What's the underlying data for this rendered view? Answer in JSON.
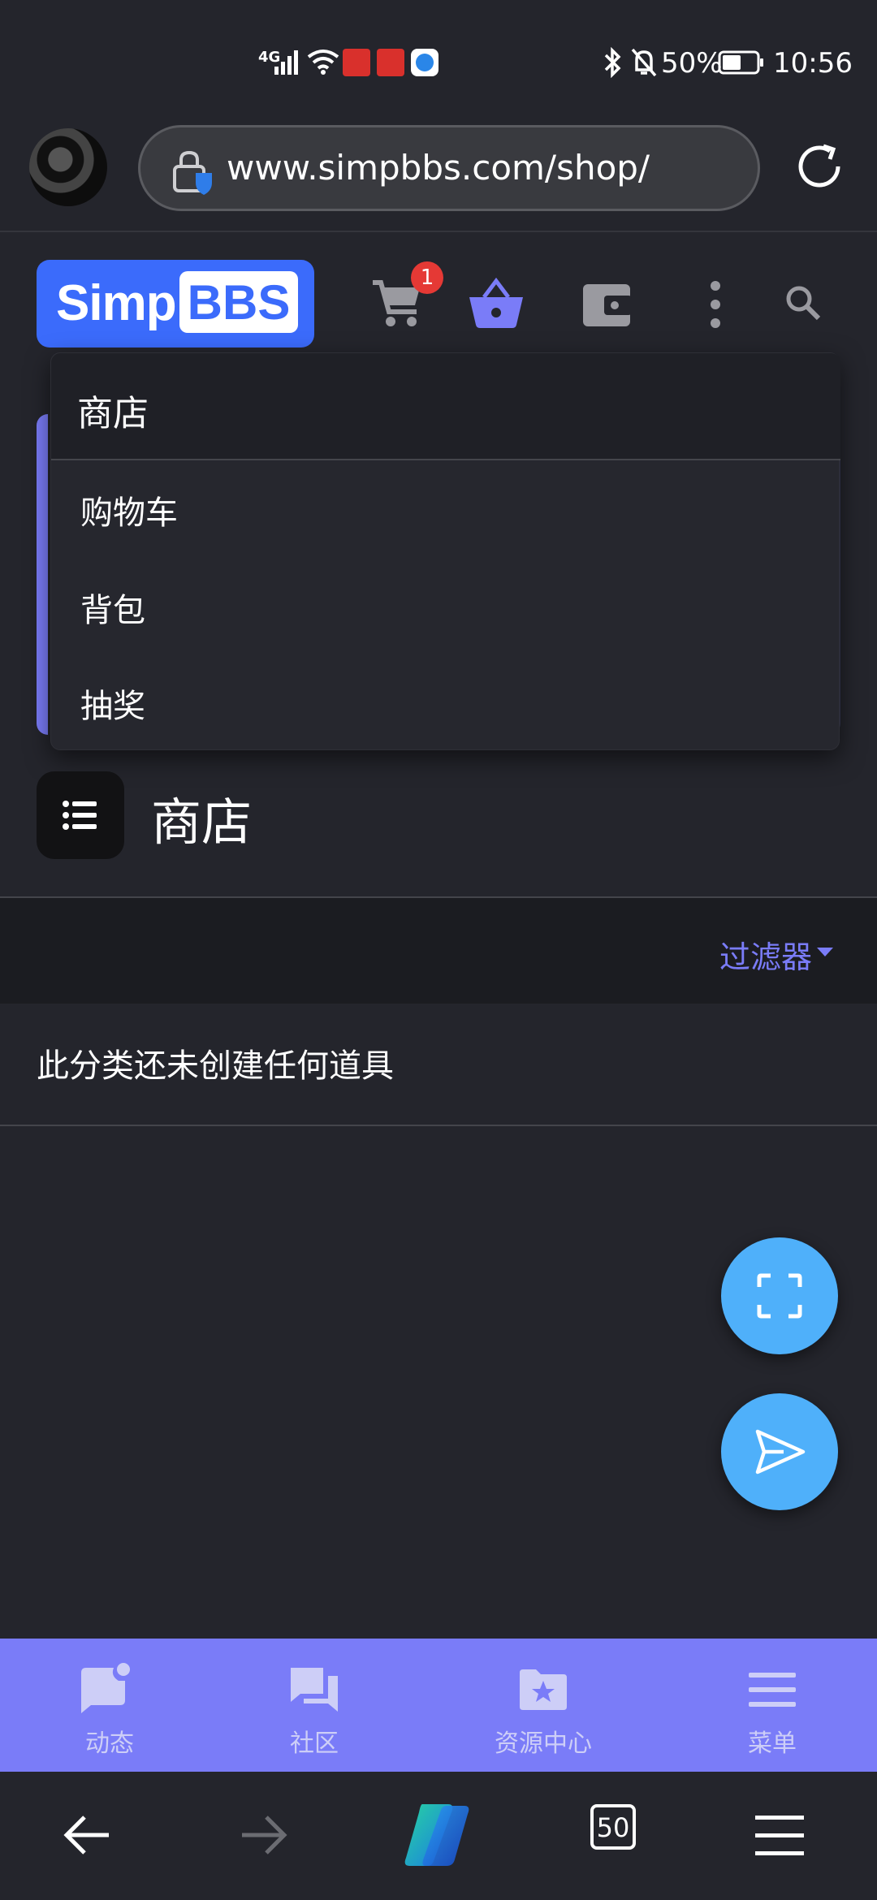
{
  "status_bar": {
    "network": "4G",
    "battery": "50%",
    "time": "10:56"
  },
  "browser": {
    "url": "www.simpbbs.com/shop/"
  },
  "site": {
    "logo_left": "Simp",
    "logo_right": "BBS",
    "cart_count": "1"
  },
  "dropdown": {
    "title": "商店",
    "items": [
      {
        "label": "购物车"
      },
      {
        "label": "背包"
      },
      {
        "label": "抽奖"
      }
    ]
  },
  "page": {
    "title": "商店",
    "filter_label": "过滤器",
    "empty_message": "此分类还未创建任何道具"
  },
  "site_nav": {
    "items": [
      {
        "label": "动态",
        "icon": "activity-icon"
      },
      {
        "label": "社区",
        "icon": "forum-icon"
      },
      {
        "label": "资源中心",
        "icon": "resource-folder-icon"
      },
      {
        "label": "菜单",
        "icon": "menu-icon"
      }
    ]
  },
  "browser_nav": {
    "tab_count": "50"
  },
  "colors": {
    "background": "#24252c",
    "accent": "#7a7cf8",
    "logo_blue": "#3b6bfb",
    "fab_blue": "#4fb0fa",
    "badge_red": "#e53935"
  }
}
